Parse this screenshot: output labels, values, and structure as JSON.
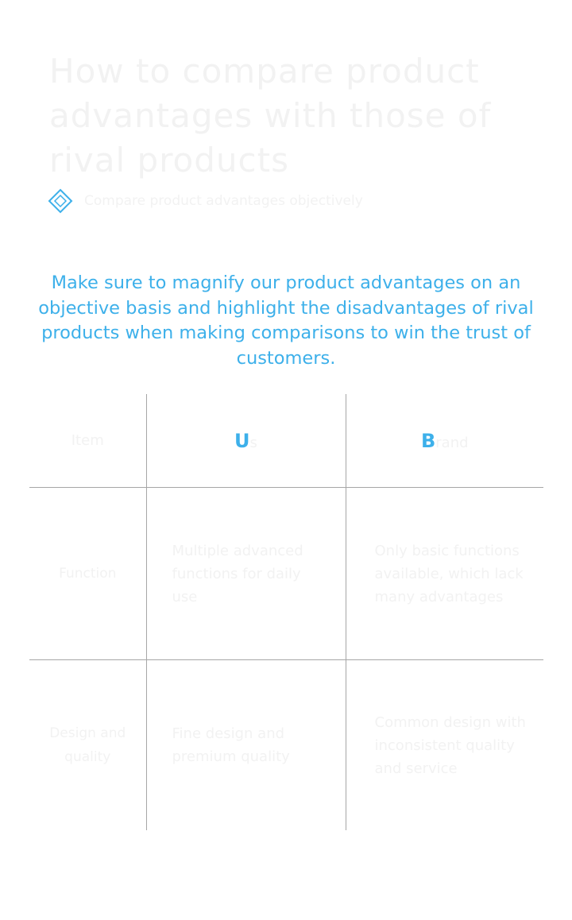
{
  "page": {
    "title": "How to compare product advantages with those of rival products",
    "subtitle": "Compare product advantages objectively",
    "lead": "Make sure to magnify our product advantages on an objective basis and highlight the disadvantages of rival products when making comparisons to win the trust of customers."
  },
  "table": {
    "head": {
      "col1": "Item",
      "col2_initial": "U",
      "col2_rest": "s",
      "col3_initial": "B",
      "col3_rest": "rand"
    },
    "rows": [
      {
        "label": "Function",
        "ours": "Multiple advanced functions for daily use",
        "rival": "Only basic functions available, which lack many advantages"
      },
      {
        "label": "Design and quality",
        "ours": "Fine design and premium quality",
        "rival": "Common design with inconsistent quality and service"
      }
    ]
  },
  "colors": {
    "accent": "#3db0ea",
    "faded_text": "#f2f2f2",
    "grid_line": "#a6a6a6",
    "background": "#ffffff"
  },
  "icons": {
    "subtitle_marker": "diamond-icon"
  }
}
